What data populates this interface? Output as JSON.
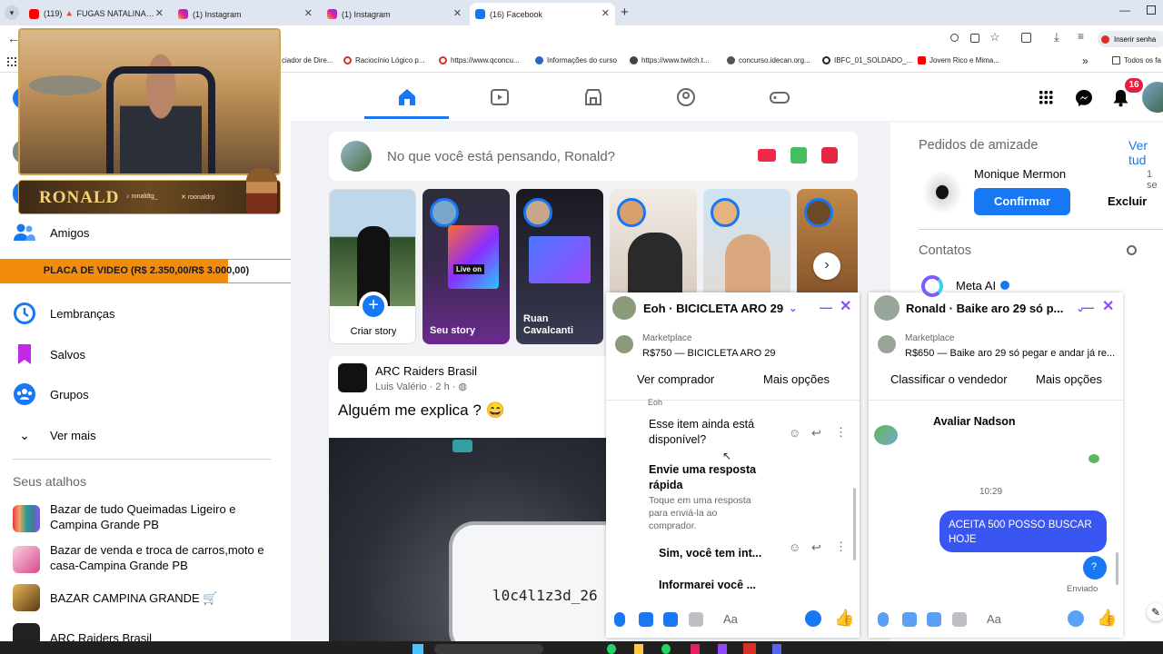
{
  "browser": {
    "tabs": [
      {
        "label": "(119) 🔺 FUGAS NATALINAS 🔺",
        "color": "#ff0000"
      },
      {
        "label": "(1) Instagram",
        "color": "#d6249f"
      },
      {
        "label": "(1) Instagram",
        "color": "#d6249f"
      },
      {
        "label": "(16) Facebook",
        "color": "#1877f2"
      }
    ],
    "new_tab": "+",
    "password_button": "Inserir senha",
    "bookmarks": [
      "ciador de Dire...",
      "Raciocínio Lógico p...",
      "https://www.qconcu...",
      "Informações do curso",
      "https://www.twitch.t...",
      "concurso.idecan.org...",
      "IBFC_01_SOLDADO_...",
      "Jovem Rico e Mima..."
    ],
    "all_bookmarks": "Todos os fa",
    "more_bookmarks": "»"
  },
  "overlay": {
    "streamer_name": "RONALD",
    "handle_1": "ronaldtg_",
    "handle_2": "roonaldrp",
    "banner_text": "PLACA DE VIDEO (R$ 2.350,00/R$ 3.000,00)",
    "banner_progress": 0.78
  },
  "header": {
    "notification_count": "16"
  },
  "sidebar": {
    "items": [
      {
        "label": "Amigos",
        "color": "#1877f2"
      },
      {
        "label": "Lembranças",
        "color": "#1877f2"
      },
      {
        "label": "Salvos",
        "color": "#c626e8"
      },
      {
        "label": "Grupos",
        "color": "#1877f2"
      },
      {
        "label": "Ver mais",
        "color": "#050505"
      }
    ],
    "shortcuts_title": "Seus atalhos",
    "shortcuts": [
      {
        "label": "Bazar de tudo Queimadas Ligeiro e Campina Grande PB"
      },
      {
        "label": "Bazar de venda e troca de carros,moto e casa-Campina Grande PB"
      },
      {
        "label": "BAZAR CAMPINA GRANDE 🛒"
      },
      {
        "label": "ARC Raiders Brasil"
      }
    ]
  },
  "composer": {
    "placeholder": "No que você está pensando, Ronald?"
  },
  "stories": [
    {
      "label": "Criar story"
    },
    {
      "label": "Seu story",
      "badge": "Live on"
    },
    {
      "label": "Ruan Cavalcanti"
    },
    {
      "label": ""
    },
    {
      "label": ""
    },
    {
      "label": ""
    }
  ],
  "post": {
    "group": "ARC Raiders Brasil",
    "author": "Luis Valério · 2 h · ",
    "text": "Alguém me explica ? 😄",
    "image_code": "l0c4l1z3d_26"
  },
  "chat1": {
    "title": "Eoh · BICICLETA ARO 29",
    "marketplace_label": "Marketplace",
    "listing": "R$750 — BICICLETA ARO 29",
    "btn_left": "Ver comprador",
    "btn_right": "Mais opções",
    "sender": "Eoh",
    "msg_question": "Esse item ainda está disponível?",
    "quick_title": "Envie uma resposta rápida",
    "quick_sub": "Toque em uma resposta para enviá-la ao comprador.",
    "quick_1": "Sim, você tem int...",
    "quick_2": "Informarei você ...",
    "input_placeholder": "Aa"
  },
  "chat2": {
    "title": "Ronald · Baike aro 29 só p...",
    "marketplace_label": "Marketplace",
    "listing": "R$650 — Baike aro 29 só pegar e andar já re...",
    "btn_left": "Classificar o vendedor",
    "btn_right": "Mais opções",
    "rate_label": "Avaliar Nadson",
    "time": "10:29",
    "my_message": "ACEITA 500 POSSO BUSCAR HOJE",
    "my_message2": "?",
    "status": "Enviado",
    "input_placeholder": "Aa"
  },
  "right": {
    "friend_requests_title": "Pedidos de amizade",
    "see_all": "Ver tud",
    "request_name": "Monique Mermon",
    "request_time": "1 se",
    "confirm": "Confirmar",
    "delete": "Excluir",
    "contacts_title": "Contatos",
    "contact_1": "Meta AI"
  },
  "colors": {
    "fb_blue": "#1877f2",
    "chat_bubble": "#3a56f2",
    "banner_orange": "#f28c0f"
  }
}
